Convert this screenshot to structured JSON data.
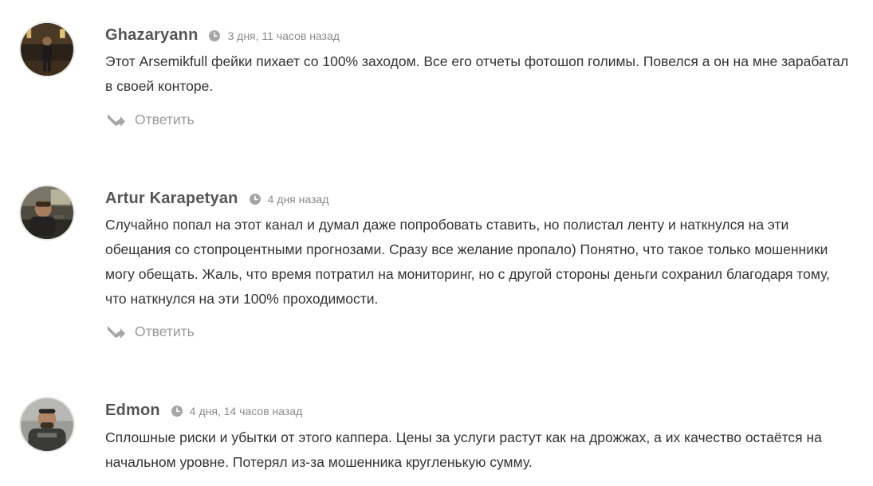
{
  "comments": [
    {
      "author": "Ghazaryann",
      "date": "3 дня, 11 часов назад",
      "text": "Этот Arsemikfull фейки пихает со 100% заходом. Все его отчеты фотошоп голимы. Повелся а он на мне зарабатал в своей конторе.",
      "reply_label": "Ответить"
    },
    {
      "author": "Artur Karapetyan",
      "date": "4 дня назад",
      "text": "Случайно попал на этот канал и думал даже попробовать ставить, но полистал ленту и наткнулся на эти обещания со стопроцентными прогнозами. Сразу все желание пропало) Понятно, что такое только мошенники могу обещать. Жаль, что время потратил на мониторинг, но с другой стороны деньги сохранил благодаря тому, что наткнулся на эти 100% проходимости.",
      "reply_label": "Ответить"
    },
    {
      "author": "Edmon",
      "date": "4 дня, 14 часов назад",
      "text": "Сплошные риски и убытки от этого каппера. Цены за услуги растут как на дрожжах, а их качество остаётся на начальном уровне. Потерял из-за мошенника кругленькую сумму."
    }
  ],
  "icons": {
    "clock": "clock-icon",
    "reply": "reply-arrow-icon"
  },
  "colors": {
    "author": "#555555",
    "date": "#8a8a8a",
    "text": "#333333",
    "reply": "#999999",
    "icon": "#a6a6a6"
  }
}
